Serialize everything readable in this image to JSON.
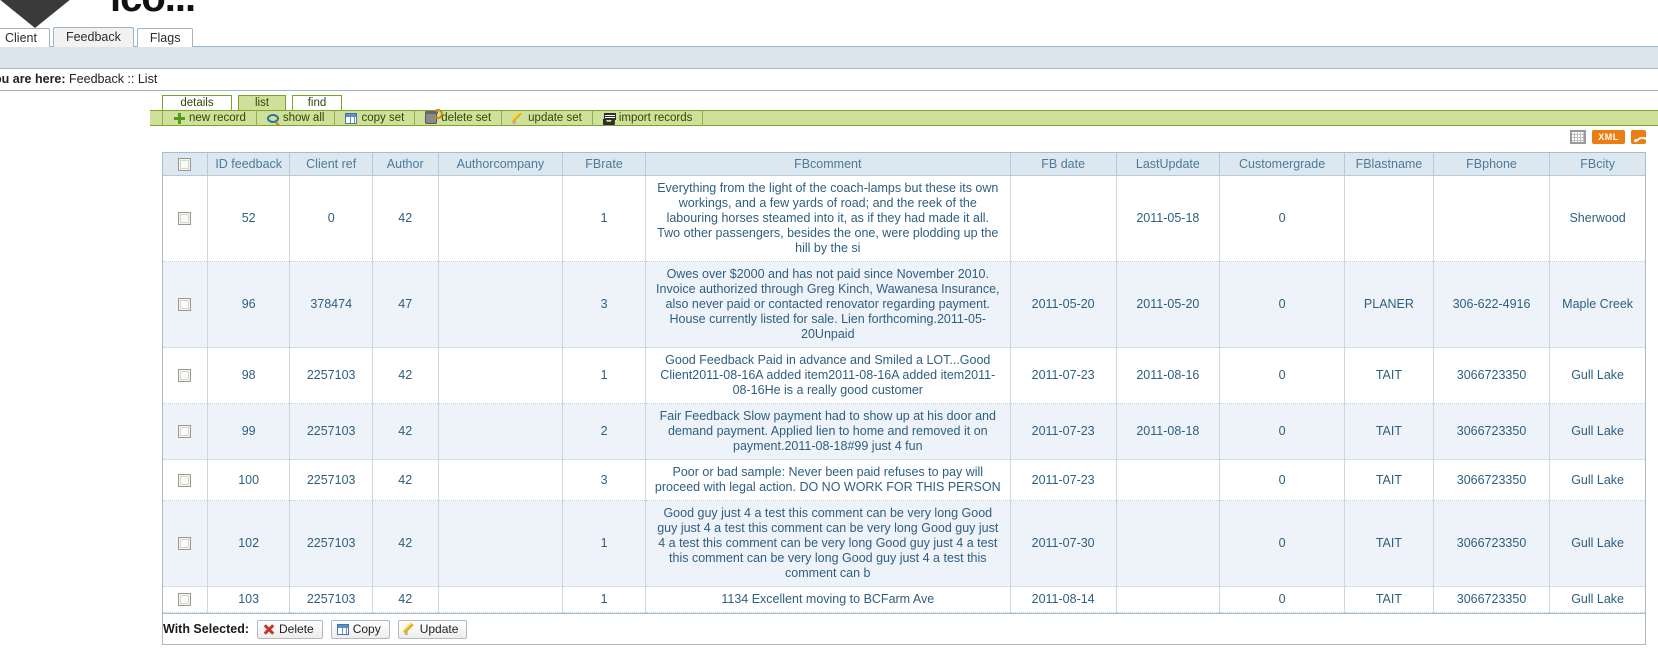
{
  "brand": {
    "logo_text": "ico..."
  },
  "main_tabs": [
    {
      "label": "Client",
      "active": false
    },
    {
      "label": "Feedback",
      "active": true
    },
    {
      "label": "Flags",
      "active": false
    }
  ],
  "breadcrumb": {
    "label": "ou are here:",
    "path": "Feedback :: List"
  },
  "sub_tabs": [
    {
      "label": "details",
      "active": false
    },
    {
      "label": "list",
      "active": true
    },
    {
      "label": "find",
      "active": false
    }
  ],
  "toolbar": [
    {
      "label": "new record",
      "icon": "plus-icon"
    },
    {
      "label": "show all",
      "icon": "magnifier-icon"
    },
    {
      "label": "copy set",
      "icon": "grid-copy-icon"
    },
    {
      "label": "delete set",
      "icon": "trash-icon"
    },
    {
      "label": "update set",
      "icon": "pencil-icon"
    },
    {
      "label": "import records",
      "icon": "import-icon"
    }
  ],
  "export": {
    "grid_icon": "spreadsheet-icon",
    "xml_label": "XML",
    "rss_icon": "rss-icon"
  },
  "table": {
    "columns": [
      "",
      "ID feedback",
      "Client ref",
      "Author",
      "Authorcompany",
      "FBrate",
      "FBcomment",
      "FB date",
      "LastUpdate",
      "Customergrade",
      "FBlastname",
      "FBphone",
      "FBcity"
    ],
    "rows": [
      {
        "id": "52",
        "client_ref": "0",
        "author": "42",
        "authorcompany": "",
        "fbrate": "1",
        "fbcomment": "Everything from the light of the coach-lamps but these its own workings, and a few yards of road; and the reek of the labouring horses steamed into it, as if they had made it all. Two other passengers, besides the one, were plodding up the hill by the si",
        "fbdate": "",
        "lastupdate": "2011-05-18",
        "customergrade": "0",
        "fblastname": "",
        "fbphone": "",
        "fbcity": "Sherwood"
      },
      {
        "id": "96",
        "client_ref": "378474",
        "author": "47",
        "authorcompany": "",
        "fbrate": "3",
        "fbcomment": "Owes over $2000 and has not paid since November 2010. Invoice authorized through Greg Kinch, Wawanesa Insurance, also never paid or contacted renovator regarding payment. House currently listed for sale. Lien forthcoming.2011-05-20Unpaid",
        "fbdate": "2011-05-20",
        "lastupdate": "2011-05-20",
        "customergrade": "0",
        "fblastname": "PLANER",
        "fbphone": "306-622-4916",
        "fbcity": "Maple Creek"
      },
      {
        "id": "98",
        "client_ref": "2257103",
        "author": "42",
        "authorcompany": "",
        "fbrate": "1",
        "fbcomment": "Good Feedback Paid in advance and Smiled a LOT...Good Client2011-08-16A added item2011-08-16A added item2011-08-16He is a really good customer",
        "fbdate": "2011-07-23",
        "lastupdate": "2011-08-16",
        "customergrade": "0",
        "fblastname": "TAIT",
        "fbphone": "3066723350",
        "fbcity": "Gull Lake"
      },
      {
        "id": "99",
        "client_ref": "2257103",
        "author": "42",
        "authorcompany": "",
        "fbrate": "2",
        "fbcomment": "Fair Feedback Slow payment had to show up at his door and demand payment. Applied lien to home and removed it on payment.2011-08-18#99 just 4 fun",
        "fbdate": "2011-07-23",
        "lastupdate": "2011-08-18",
        "customergrade": "0",
        "fblastname": "TAIT",
        "fbphone": "3066723350",
        "fbcity": "Gull Lake"
      },
      {
        "id": "100",
        "client_ref": "2257103",
        "author": "42",
        "authorcompany": "",
        "fbrate": "3",
        "fbcomment": "Poor or bad sample: Never been paid refuses to pay will proceed with legal action. DO NO WORK FOR THIS PERSON",
        "fbdate": "2011-07-23",
        "lastupdate": "",
        "customergrade": "0",
        "fblastname": "TAIT",
        "fbphone": "3066723350",
        "fbcity": "Gull Lake"
      },
      {
        "id": "102",
        "client_ref": "2257103",
        "author": "42",
        "authorcompany": "",
        "fbrate": "1",
        "fbcomment": "Good guy just 4 a test this comment can be very long Good guy just 4 a test this comment can be very long Good guy just 4 a test this comment can be very long Good guy just 4 a test this comment can be very long Good guy just 4 a test this comment can b",
        "fbdate": "2011-07-30",
        "lastupdate": "",
        "customergrade": "0",
        "fblastname": "TAIT",
        "fbphone": "3066723350",
        "fbcity": "Gull Lake"
      },
      {
        "id": "103",
        "client_ref": "2257103",
        "author": "42",
        "authorcompany": "",
        "fbrate": "1",
        "fbcomment": "1134 Excellent moving to BCFarm Ave",
        "fbdate": "2011-08-14",
        "lastupdate": "",
        "customergrade": "0",
        "fblastname": "TAIT",
        "fbphone": "3066723350",
        "fbcity": "Gull Lake"
      }
    ]
  },
  "footer": {
    "with_selected_label": "With Selected:",
    "buttons": [
      {
        "label": "Delete",
        "icon": "delete-x-icon"
      },
      {
        "label": "Copy",
        "icon": "copy-icon"
      },
      {
        "label": "Update",
        "icon": "pencil-icon"
      }
    ]
  }
}
